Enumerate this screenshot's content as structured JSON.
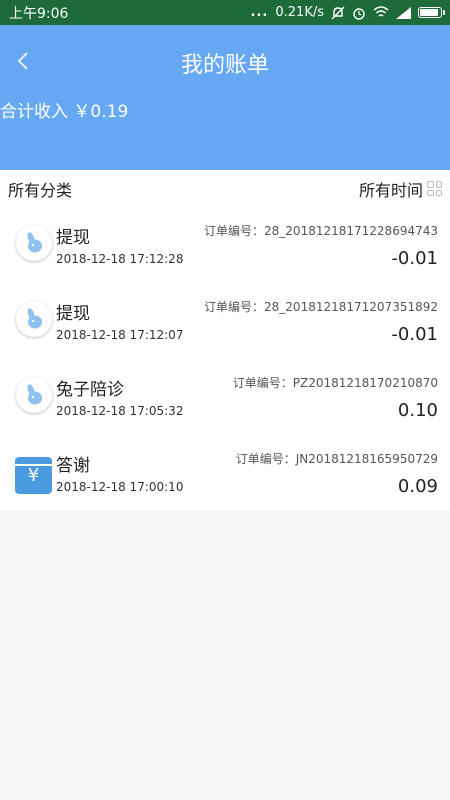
{
  "status_bar": {
    "time": "上午9:06",
    "dots": "...",
    "speed": "0.21K/s",
    "battery_level": 0.9
  },
  "header": {
    "title": "我的账单",
    "back_icon": "chevron-left-icon",
    "total_label": "合计收入",
    "total_value": "￥0.19"
  },
  "filters": {
    "category": "所有分类",
    "time": "所有时间"
  },
  "bills": [
    {
      "title": "提现",
      "date": "2018-12-18 17:12:28",
      "order": "订单编号：28_20181218171228694743",
      "amount": "-0.01",
      "icon": "rabbit-avatar-icon"
    },
    {
      "title": "提现",
      "date": "2018-12-18 17:12:07",
      "order": "订单编号：28_20181218171207351892",
      "amount": "-0.01",
      "icon": "rabbit-avatar-icon"
    },
    {
      "title": "兔子陪诊",
      "date": "2018-12-18 17:05:32",
      "order": "订单编号：PZ20181218170210870",
      "amount": "0.10",
      "icon": "rabbit-avatar-icon"
    },
    {
      "title": "答谢",
      "date": "2018-12-18 17:00:10",
      "order": "订单编号：JN20181218165950729",
      "amount": "0.09",
      "icon": "yen-wallet-icon",
      "icon_glyph": "¥"
    }
  ],
  "colors": {
    "header": "#66a8f3",
    "status_bar": "#1e6b3a"
  }
}
